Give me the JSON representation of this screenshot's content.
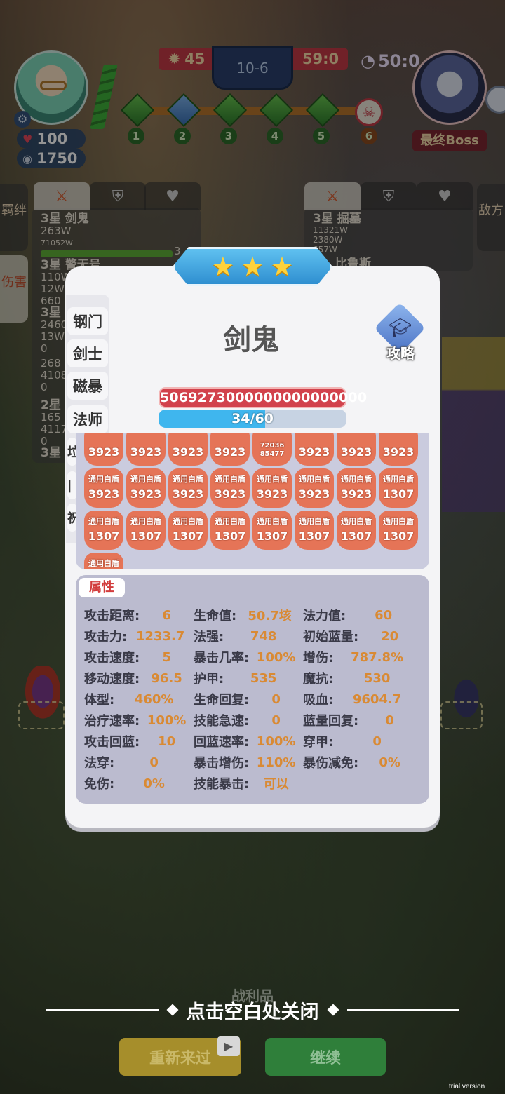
{
  "hud": {
    "player_hp": "100",
    "player_gold": "1750",
    "score_left": "45",
    "round": "10-6",
    "score_right": "59:0",
    "timer": "50:0",
    "stages": [
      "1",
      "2",
      "3",
      "4",
      "5",
      "6"
    ],
    "boss_label": "最终Boss"
  },
  "left_panel": {
    "tabs": [
      "羁绊",
      "伤害"
    ],
    "units": [
      {
        "title": "3星 剑鬼",
        "lines": [
          "263W",
          "71052W"
        ],
        "bar_value": "3"
      },
      {
        "title": "3星 警无号",
        "lines": [
          "110W",
          "12W",
          "660"
        ]
      },
      {
        "title": "3星",
        "lines": [
          "2460",
          "13W",
          "0"
        ]
      },
      {
        "title": "3星",
        "lines": [
          "268",
          "4108",
          "0"
        ]
      },
      {
        "title": "2星",
        "lines": [
          "165",
          "41177",
          "0"
        ]
      },
      {
        "title": "3星",
        "lines": []
      }
    ]
  },
  "right_panel": {
    "tab": "敌方",
    "units": [
      {
        "title": "3星 掘墓",
        "lines": [
          "11321W",
          "2380W",
          "657W"
        ]
      },
      {
        "title": "比鲁斯",
        "lines": []
      }
    ]
  },
  "modal": {
    "stars": 3,
    "traits": [
      "钢门",
      "剑士",
      "磁暴",
      "法师",
      "垃",
      "|",
      "祝"
    ],
    "name": "剑鬼",
    "guide_label": "攻略",
    "big_number": "5069273000000000000000",
    "mana_text": "34/60",
    "mana_fraction": 0.5667,
    "buffs": [
      {
        "name": "",
        "value": "3923"
      },
      {
        "name": "",
        "value": "3923"
      },
      {
        "name": "",
        "value": "3923"
      },
      {
        "name": "",
        "value": "3923"
      },
      {
        "name": "",
        "value": "72036 85477",
        "small": true
      },
      {
        "name": "",
        "value": "3923"
      },
      {
        "name": "",
        "value": "3923"
      },
      {
        "name": "",
        "value": "3923"
      },
      {
        "name": "通用白盾",
        "value": "3923"
      },
      {
        "name": "通用白盾",
        "value": "3923"
      },
      {
        "name": "通用白盾",
        "value": "3923"
      },
      {
        "name": "通用白盾",
        "value": "3923"
      },
      {
        "name": "通用白盾",
        "value": "3923"
      },
      {
        "name": "通用白盾",
        "value": "3923"
      },
      {
        "name": "通用白盾",
        "value": "3923"
      },
      {
        "name": "通用白盾",
        "value": "1307"
      },
      {
        "name": "通用白盾",
        "value": "1307"
      },
      {
        "name": "通用白盾",
        "value": "1307"
      },
      {
        "name": "通用白盾",
        "value": "1307"
      },
      {
        "name": "通用白盾",
        "value": "1307"
      },
      {
        "name": "通用白盾",
        "value": "1307"
      },
      {
        "name": "通用白盾",
        "value": "1307"
      },
      {
        "name": "通用白盾",
        "value": "1307"
      },
      {
        "name": "通用白盾",
        "value": "1307"
      },
      {
        "name": "通用白盾",
        "value": "1307"
      }
    ],
    "attr_title": "属性",
    "attrs": [
      {
        "k": "攻击距离:",
        "v": "6"
      },
      {
        "k": "生命值:",
        "v": "50.7垓"
      },
      {
        "k": "法力值:",
        "v": "60"
      },
      {
        "k": "攻击力:",
        "v": "1233.7"
      },
      {
        "k": "法强:",
        "v": "748"
      },
      {
        "k": "初始蓝量:",
        "v": "20"
      },
      {
        "k": "攻击速度:",
        "v": "5"
      },
      {
        "k": "暴击几率:",
        "v": "100%"
      },
      {
        "k": "增伤:",
        "v": "787.8%"
      },
      {
        "k": "移动速度:",
        "v": "96.5"
      },
      {
        "k": "护甲:",
        "v": "535"
      },
      {
        "k": "魔抗:",
        "v": "530"
      },
      {
        "k": "体型:",
        "v": "460%"
      },
      {
        "k": "生命回复:",
        "v": "0"
      },
      {
        "k": "吸血:",
        "v": "9604.7"
      },
      {
        "k": "治疗速率:",
        "v": "100%"
      },
      {
        "k": "技能急速:",
        "v": "0"
      },
      {
        "k": "蓝量回复:",
        "v": "0"
      },
      {
        "k": "攻击回蓝:",
        "v": "10"
      },
      {
        "k": "回蓝速率:",
        "v": "100%"
      },
      {
        "k": "穿甲:",
        "v": "0"
      },
      {
        "k": "法穿:",
        "v": "0"
      },
      {
        "k": "暴击增伤:",
        "v": "110%"
      },
      {
        "k": "暴伤减免:",
        "v": "0%"
      },
      {
        "k": "免伤:",
        "v": "0%"
      },
      {
        "k": "技能暴击:",
        "v": "可以"
      }
    ]
  },
  "footer": {
    "close_hint": "点击空白处关闭",
    "loot_label": "战利品",
    "retry": "重新来过",
    "continue": "继续",
    "watermark": "trial version"
  }
}
